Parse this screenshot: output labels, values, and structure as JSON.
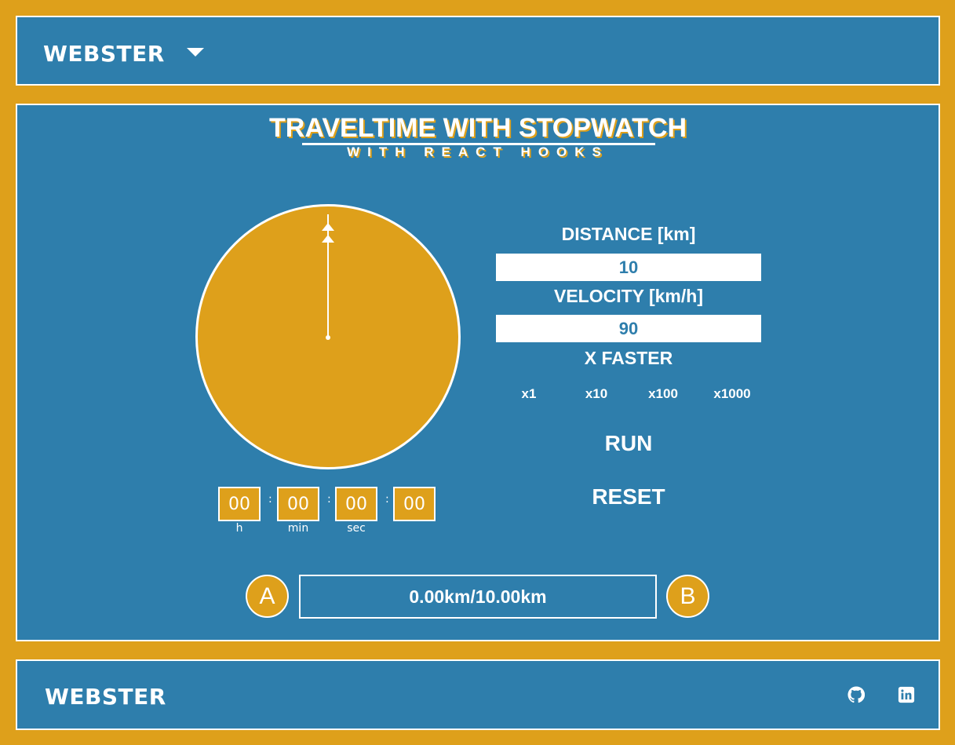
{
  "header": {
    "brand": "WEBSTER"
  },
  "main": {
    "title": "TRAVELTIME WITH STOPWATCH",
    "subtitle": "WITH REACT HOOKS",
    "stopwatch": {
      "hours": "00",
      "minutes": "00",
      "seconds": "00",
      "hundredths": "00",
      "separator": ":",
      "unit_hours": "h",
      "unit_minutes": "min",
      "unit_seconds": "sec"
    },
    "distance_label": "DISTANCE [km]",
    "distance_value": "10",
    "velocity_label": "VELOCITY [km/h]",
    "velocity_value": "90",
    "faster_label": "X FASTER",
    "multipliers": [
      "x1",
      "x10",
      "x100",
      "x1000"
    ],
    "run_label": "RUN",
    "reset_label": "RESET",
    "route": {
      "start": "A",
      "end": "B",
      "progress_text": "0.00km/10.00km",
      "progress_fraction": 0
    }
  },
  "footer": {
    "brand": "WEBSTER",
    "icons": [
      "github-icon",
      "linkedin-icon"
    ]
  },
  "colors": {
    "accent": "#dea01b",
    "panel": "#2e7eac",
    "text": "#ffffff"
  }
}
